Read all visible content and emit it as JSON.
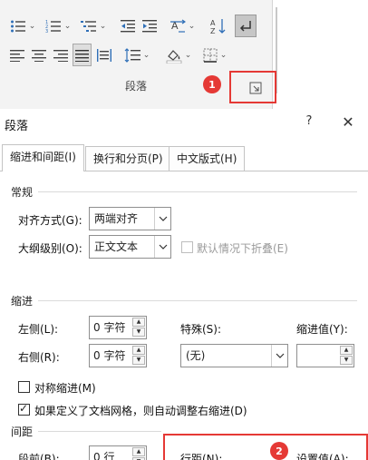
{
  "ribbon": {
    "group_label": "段落",
    "badge1": "1",
    "icons": [
      "bullets-icon",
      "numbering-icon",
      "multilevel-list-icon",
      "decrease-indent-icon",
      "increase-indent-icon",
      "text-direction-icon",
      "sort-icon",
      "show-marks-icon",
      "align-left-icon",
      "align-center-icon",
      "align-right-icon",
      "justify-icon",
      "distributed-icon",
      "line-spacing-icon",
      "shading-icon",
      "borders-icon",
      "paragraph-settings-launcher-icon"
    ]
  },
  "dialog": {
    "title": "段落",
    "help": "?",
    "close": "✕",
    "tabs": [
      {
        "label": "缩进和间距(I)",
        "active": true
      },
      {
        "label": "换行和分页(P)",
        "active": false
      },
      {
        "label": "中文版式(H)",
        "active": false
      }
    ],
    "general": {
      "section": "常规",
      "alignment_label": "对齐方式(G):",
      "alignment_value": "两端对齐",
      "outline_label": "大纲级别(O):",
      "outline_value": "正文文本",
      "collapse_label": "默认情况下折叠(E)"
    },
    "indent": {
      "section": "缩进",
      "left_label": "左侧(L):",
      "left_value": "0 字符",
      "right_label": "右侧(R):",
      "right_value": "0 字符",
      "special_label": "特殊(S):",
      "special_value": "(无)",
      "by_label": "缩进值(Y):",
      "by_value": "",
      "mirror_label": "对称缩进(M)",
      "mirror_checked": false,
      "auto_adjust_label": "如果定义了文档网格，则自动调整右缩进(D)",
      "auto_adjust_checked": true
    },
    "spacing": {
      "section": "间距",
      "before_label": "段前(B):",
      "before_value": "0 行",
      "line_spacing_label": "行距(N):",
      "at_label": "设置值(A):",
      "badge2": "2"
    }
  },
  "colors": {
    "accent_red": "#e53935",
    "ribbon_bg": "#f3f3f3",
    "border": "#8f8f8f"
  }
}
